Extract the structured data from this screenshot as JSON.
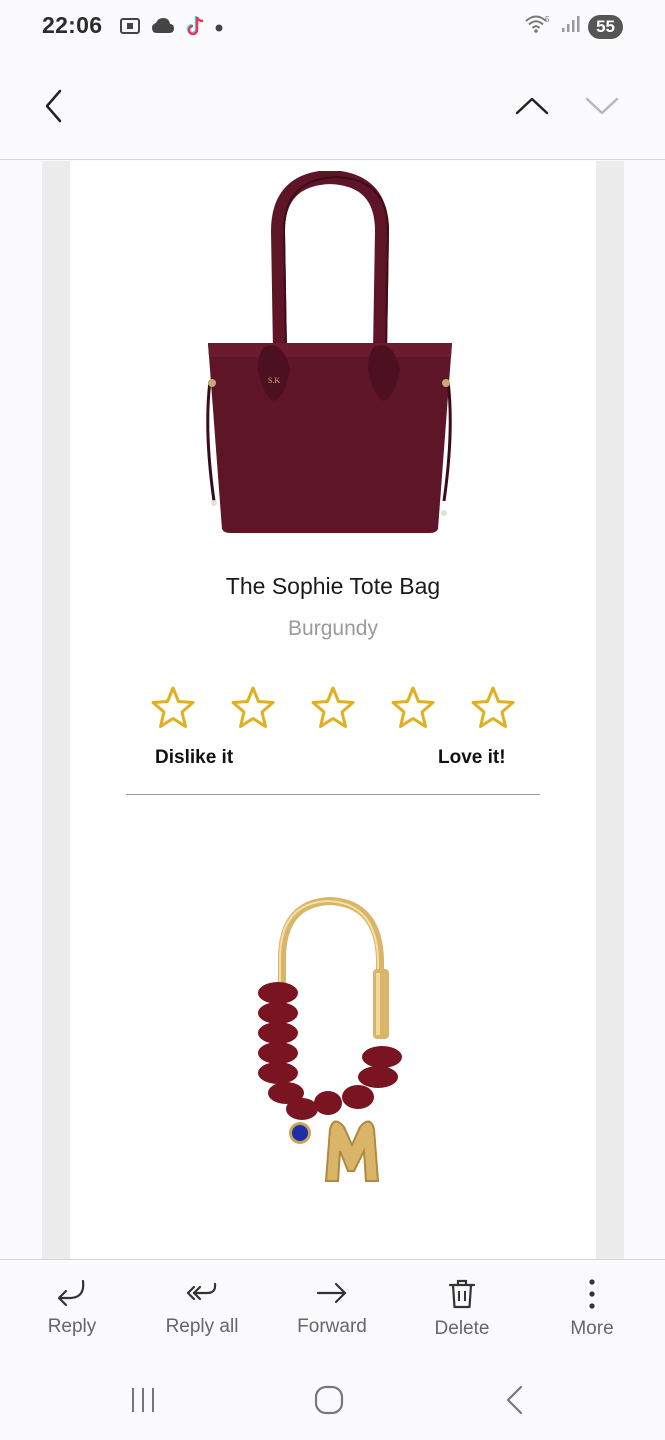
{
  "status_bar": {
    "time": "22:06",
    "battery": "55",
    "icons_left": [
      "screenshot-icon",
      "cloud-icon",
      "tiktok-icon",
      "dot-icon"
    ],
    "icons_right": [
      "wifi-icon",
      "signal-icon"
    ]
  },
  "nav": {
    "back_icon": "chevron-left-icon",
    "prev_icon": "chevron-up-icon",
    "next_icon": "chevron-down-icon"
  },
  "product": {
    "title": "The Sophie Tote Bag",
    "color": "Burgundy",
    "rating": {
      "stars": 5,
      "low_label": "Dislike it",
      "high_label": "Love it!",
      "star_color": "#e0b020"
    },
    "bag_color": "#5e1528"
  },
  "toolbar": {
    "reply": "Reply",
    "reply_all": "Reply all",
    "forward": "Forward",
    "delete": "Delete",
    "more": "More"
  },
  "system_nav": {
    "recents_icon": "recents-icon",
    "home_icon": "home-icon",
    "back_icon": "back-icon"
  }
}
